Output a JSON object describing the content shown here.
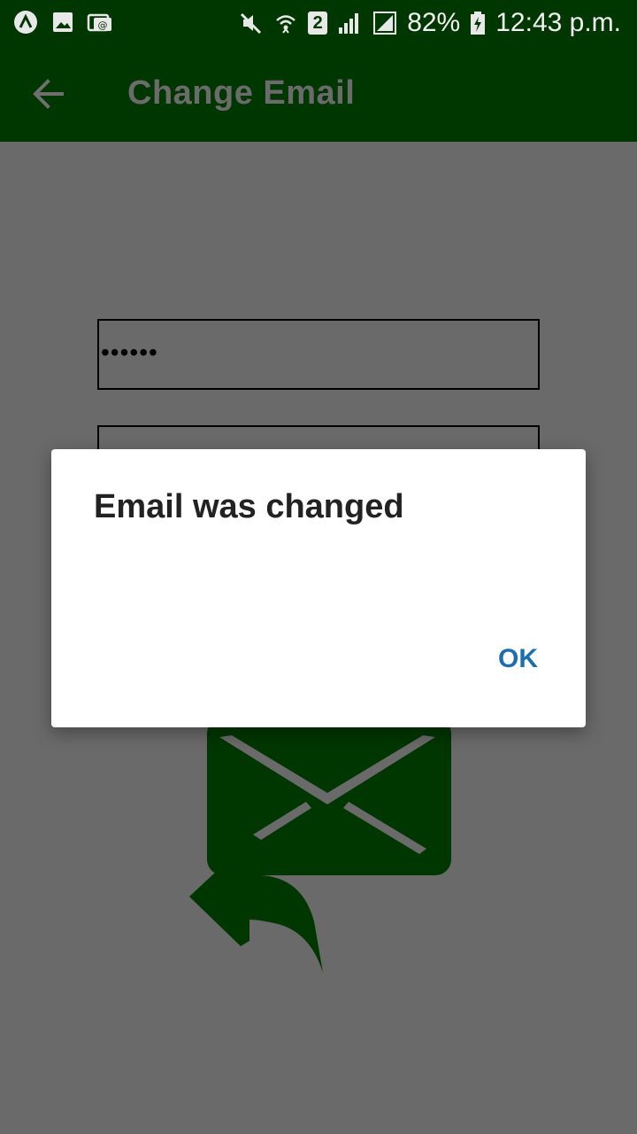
{
  "status_bar": {
    "battery": "82%",
    "time": "12:43 p.m.",
    "sim_slot": "2",
    "icons_left": [
      "android-icon",
      "image-icon",
      "email-notification-icon"
    ],
    "icons_right": [
      "mute-icon",
      "wifi-icon",
      "sim-icon",
      "signal-icon",
      "signal-box-icon",
      "battery-icon"
    ]
  },
  "appbar": {
    "title": "Change Email",
    "back_icon": "arrow-left-icon"
  },
  "form": {
    "password_value": "••••••",
    "email_value": ""
  },
  "dialog": {
    "message": "Email was changed",
    "ok_label": "OK"
  },
  "colors": {
    "primary_dark": "#003600",
    "scrim": "#6a6a6a",
    "dialog_button": "#1b6fb1"
  }
}
